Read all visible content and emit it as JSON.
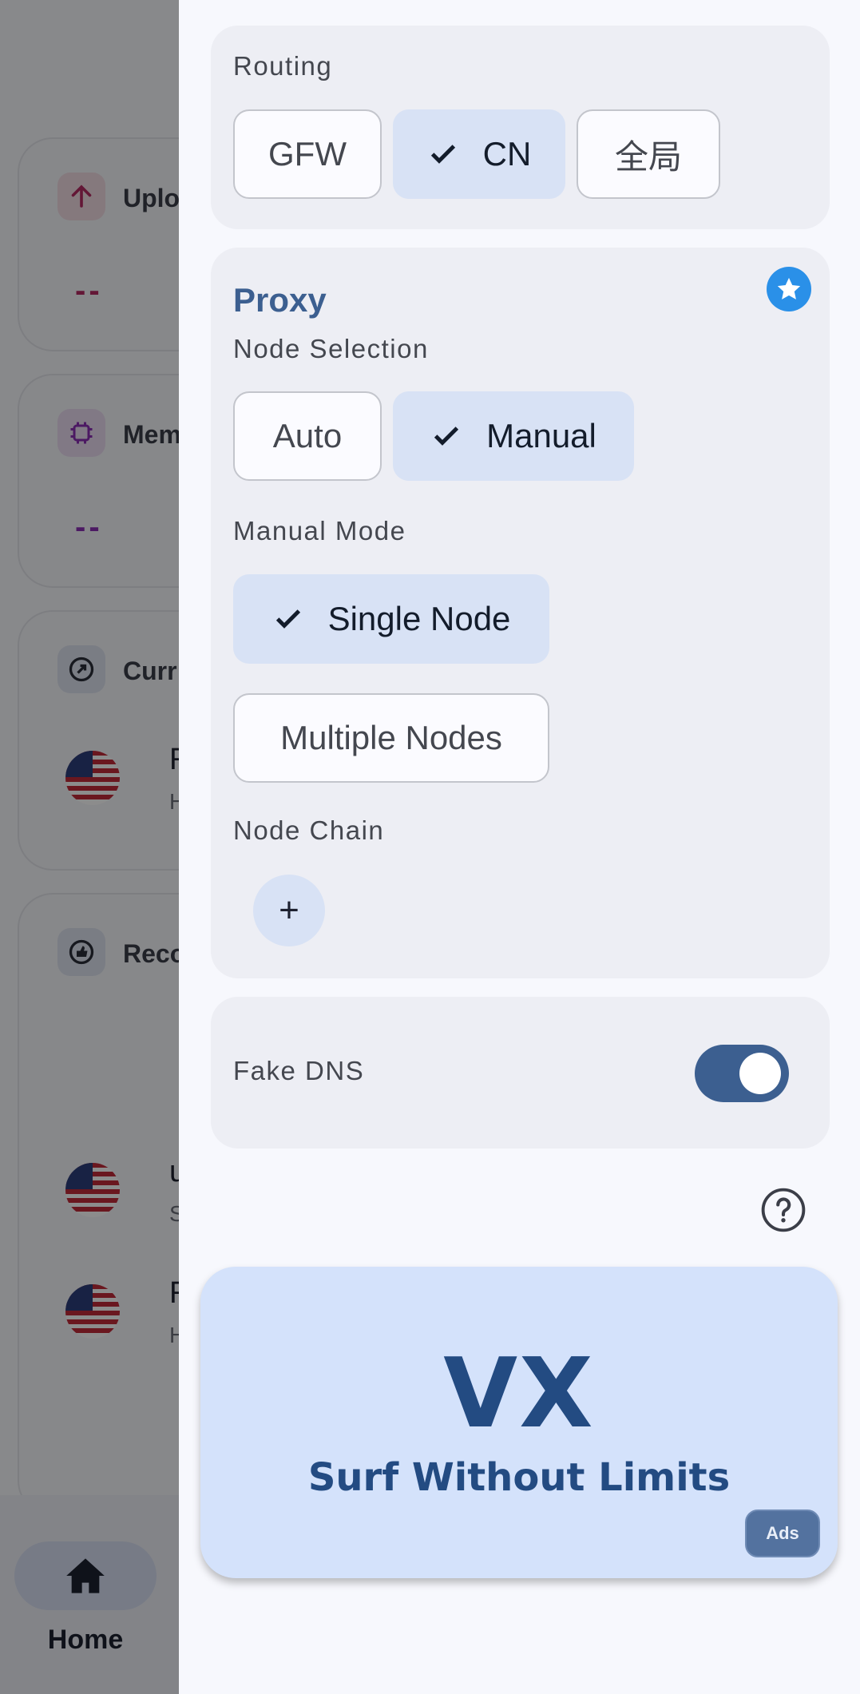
{
  "background": {
    "cards": [
      {
        "title": "Uplo",
        "value": "--",
        "value_color": "#b42a63",
        "icon": "arrow-up-icon"
      },
      {
        "title": "Mem",
        "value": "--",
        "value_color": "#8a2fb5",
        "icon": "chip-icon"
      },
      {
        "title": "Curr",
        "icon": "gauge-icon",
        "node_name": "R-",
        "node_sub": "Hy"
      },
      {
        "title": "Reco",
        "icon": "thumb-icon",
        "items": [
          {
            "name": "u",
            "sub": "So"
          },
          {
            "name": "R-",
            "sub": "Hy"
          }
        ]
      }
    ],
    "nav": {
      "home_label": "Home"
    }
  },
  "routing": {
    "label": "Routing",
    "options": [
      "GFW",
      "CN",
      "全局"
    ],
    "selected": "CN"
  },
  "proxy": {
    "title": "Proxy",
    "node_selection_label": "Node Selection",
    "node_selection_options": [
      "Auto",
      "Manual"
    ],
    "node_selection_selected": "Manual",
    "manual_mode_label": "Manual Mode",
    "manual_mode_options": [
      "Single Node",
      "Multiple Nodes"
    ],
    "manual_mode_selected": "Single Node",
    "node_chain_label": "Node Chain",
    "node_chain_add": "+"
  },
  "fake_dns": {
    "label": "Fake DNS",
    "enabled": true
  },
  "ad": {
    "logo": "VX",
    "tagline": "Surf Without Limits",
    "badge": "Ads"
  },
  "colors": {
    "accent": "#3c5f90",
    "chip_selected": "#d8e2f5",
    "star": "#2a90e8",
    "ad_bg": "#d4e2fb"
  }
}
